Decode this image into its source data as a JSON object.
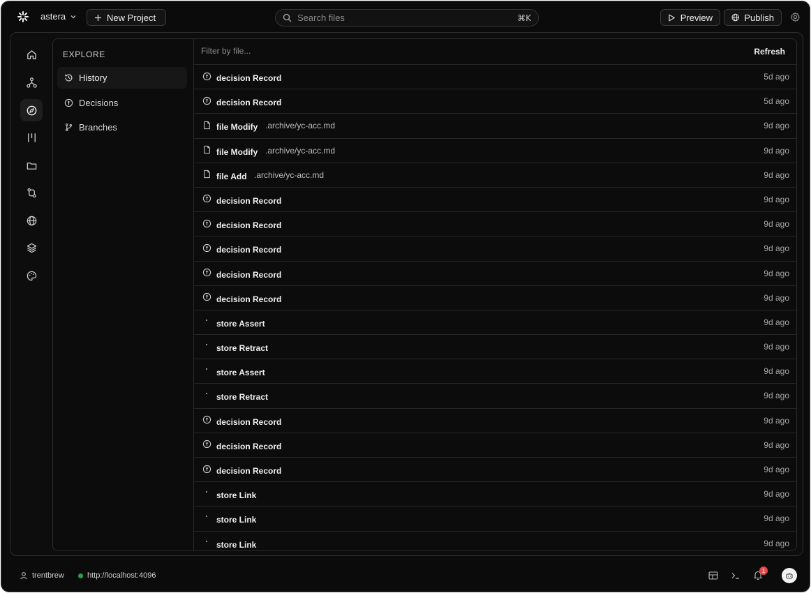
{
  "topbar": {
    "project_name": "astera",
    "new_project_label": "New Project",
    "search_placeholder": "Search files",
    "search_shortcut": "⌘K",
    "preview_label": "Preview",
    "publish_label": "Publish"
  },
  "explore": {
    "title": "EXPLORE",
    "items": [
      {
        "label": "History",
        "icon": "history-icon",
        "active": true
      },
      {
        "label": "Decisions",
        "icon": "decision-icon",
        "active": false
      },
      {
        "label": "Branches",
        "icon": "branch-icon",
        "active": false
      }
    ]
  },
  "rail": {
    "items": [
      "home-icon",
      "graph-icon",
      "compass-icon",
      "columns-icon",
      "folder-icon",
      "git-compare-icon",
      "globe-icon",
      "layers-icon",
      "palette-icon"
    ],
    "active": "compass-icon"
  },
  "history": {
    "filter_placeholder": "Filter by file...",
    "refresh_label": "Refresh",
    "rows": [
      {
        "kind": "decision Record",
        "path": "",
        "time": "5d ago",
        "icon": "decision-icon"
      },
      {
        "kind": "decision Record",
        "path": "",
        "time": "5d ago",
        "icon": "decision-icon"
      },
      {
        "kind": "file Modify",
        "path": ".archive/yc-acc.md",
        "time": "9d ago",
        "icon": "file-icon"
      },
      {
        "kind": "file Modify",
        "path": ".archive/yc-acc.md",
        "time": "9d ago",
        "icon": "file-icon"
      },
      {
        "kind": "file Add",
        "path": ".archive/yc-acc.md",
        "time": "9d ago",
        "icon": "file-icon"
      },
      {
        "kind": "decision Record",
        "path": "",
        "time": "9d ago",
        "icon": "decision-icon"
      },
      {
        "kind": "decision Record",
        "path": "",
        "time": "9d ago",
        "icon": "decision-icon"
      },
      {
        "kind": "decision Record",
        "path": "",
        "time": "9d ago",
        "icon": "decision-icon"
      },
      {
        "kind": "decision Record",
        "path": "",
        "time": "9d ago",
        "icon": "decision-icon"
      },
      {
        "kind": "decision Record",
        "path": "",
        "time": "9d ago",
        "icon": "decision-icon"
      },
      {
        "kind": "store Assert",
        "path": "",
        "time": "9d ago",
        "icon": "dot-icon"
      },
      {
        "kind": "store Retract",
        "path": "",
        "time": "9d ago",
        "icon": "dot-icon"
      },
      {
        "kind": "store Assert",
        "path": "",
        "time": "9d ago",
        "icon": "dot-icon"
      },
      {
        "kind": "store Retract",
        "path": "",
        "time": "9d ago",
        "icon": "dot-icon"
      },
      {
        "kind": "decision Record",
        "path": "",
        "time": "9d ago",
        "icon": "decision-icon"
      },
      {
        "kind": "decision Record",
        "path": "",
        "time": "9d ago",
        "icon": "decision-icon"
      },
      {
        "kind": "decision Record",
        "path": "",
        "time": "9d ago",
        "icon": "decision-icon"
      },
      {
        "kind": "store Link",
        "path": "",
        "time": "9d ago",
        "icon": "dot-icon"
      },
      {
        "kind": "store Link",
        "path": "",
        "time": "9d ago",
        "icon": "dot-icon"
      },
      {
        "kind": "store Link",
        "path": "",
        "time": "9d ago",
        "icon": "dot-icon"
      }
    ]
  },
  "statusbar": {
    "username": "trentbrew",
    "server_url": "http://localhost:4096",
    "notification_count": "1",
    "server_status_color": "#22a34a",
    "badge_color": "#e5484d"
  }
}
